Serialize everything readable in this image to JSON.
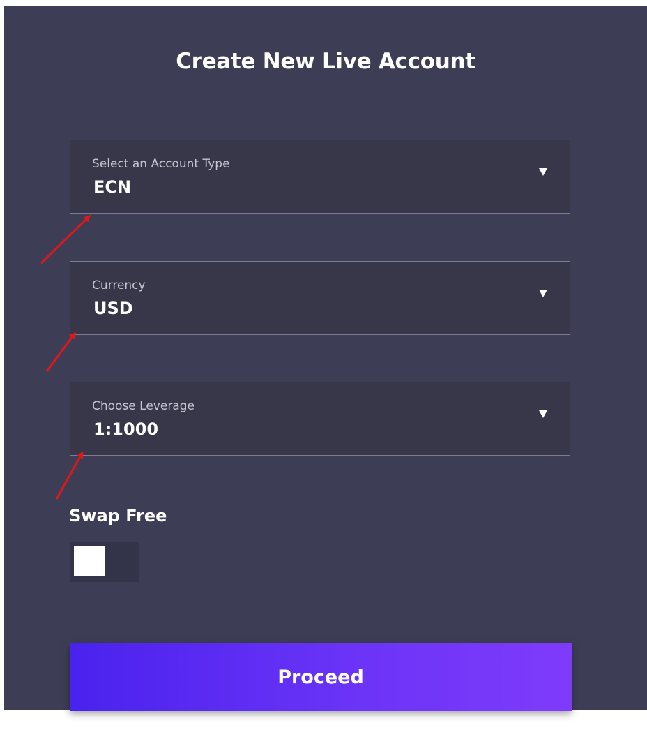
{
  "form": {
    "title": "Create New Live Account",
    "account_type": {
      "label": "Select an Account Type",
      "value": "ECN"
    },
    "currency": {
      "label": "Currency",
      "value": "USD"
    },
    "leverage": {
      "label": "Choose Leverage",
      "value": "1:1000"
    },
    "swap_free": {
      "label": "Swap Free",
      "enabled": false
    },
    "proceed_label": "Proceed"
  },
  "colors": {
    "panel_background": "#3d3d55",
    "field_background": "#373749",
    "button_gradient_start": "#4a22ee",
    "button_gradient_end": "#7f3bfb",
    "annotation_arrow": "#e01818"
  },
  "icons": {
    "dropdown": "caret-down-icon",
    "annotation": "red-arrow-annotation"
  }
}
